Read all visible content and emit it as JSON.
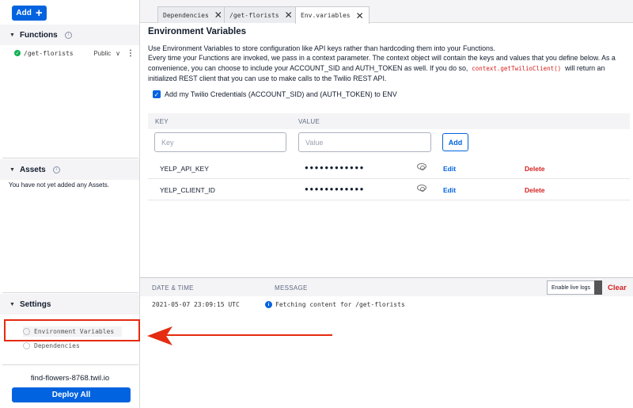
{
  "sidebar": {
    "add_label": "Add",
    "functions": {
      "title": "Functions",
      "items": [
        {
          "name": "/get-florists",
          "visibility": "Public"
        }
      ]
    },
    "assets": {
      "title": "Assets",
      "empty_text": "You have not yet added any Assets."
    },
    "settings": {
      "title": "Settings",
      "items": [
        {
          "label": "Environment Variables"
        },
        {
          "label": "Dependencies"
        }
      ]
    },
    "service_url": "find-flowers-8768.twil.io",
    "deploy_label": "Deploy All"
  },
  "tabs": [
    {
      "label": "Dependencies"
    },
    {
      "label": "/get-florists"
    },
    {
      "label": "Env.variables",
      "active": true
    }
  ],
  "main": {
    "title": "Environment Variables",
    "desc_line1": "Use Environment Variables to store configuration like API keys rather than hardcoding them into your Functions.",
    "desc_line2a": "Every time your Functions are invoked, we pass in a context parameter. The context object will contain the keys and values that you define below. As a convenience, you can choose to include your ACCOUNT_SID and AUTH_TOKEN as well. If you do so,",
    "desc_code": "context.getTwilioClient()",
    "desc_line2b": "will return an initialized REST client that you can use to make calls to the Twilio REST API.",
    "cred_label": "Add my Twilio Credentials (ACCOUNT_SID) and (AUTH_TOKEN) to ENV",
    "table": {
      "col_key": "KEY",
      "col_value": "VALUE",
      "key_placeholder": "Key",
      "value_placeholder": "Value",
      "add_label": "Add",
      "rows": [
        {
          "key": "YELP_API_KEY",
          "value": "●●●●●●●●●●●●",
          "edit": "Edit",
          "delete": "Delete"
        },
        {
          "key": "YELP_CLIENT_ID",
          "value": "●●●●●●●●●●●●",
          "edit": "Edit",
          "delete": "Delete"
        }
      ]
    }
  },
  "logs": {
    "col_datetime": "DATE & TIME",
    "col_message": "MESSAGE",
    "live_logs_label": "Enable live logs",
    "clear_label": "Clear",
    "entries": [
      {
        "timestamp": "2021-05-07 23:09:15 UTC",
        "message": "Fetching content for /get-florists"
      }
    ]
  },
  "annotation": {
    "arrow_color": "#e52b10",
    "box_color": "#e52b10"
  },
  "colors": {
    "primary": "#0263e0",
    "danger": "#d61f1f",
    "success": "#14b053"
  }
}
